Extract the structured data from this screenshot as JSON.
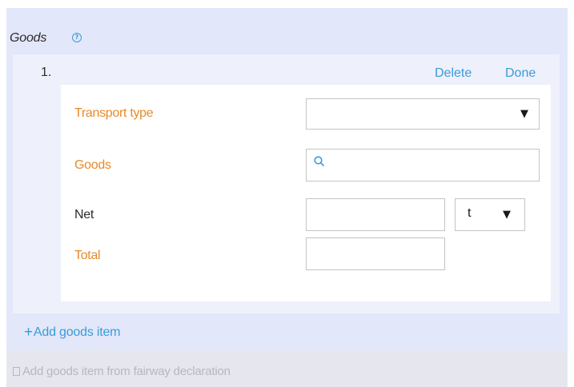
{
  "section": {
    "title": "Goods",
    "help_icon": "?"
  },
  "item": {
    "number": "1.",
    "delete_label": "Delete",
    "done_label": "Done",
    "fields": {
      "transport_type": {
        "label": "Transport type",
        "value": "",
        "required": true
      },
      "goods": {
        "label": "Goods",
        "value": "",
        "required": true,
        "icon": "search-icon"
      },
      "net": {
        "label": "Net",
        "value": "",
        "unit": "t",
        "required": false
      },
      "total": {
        "label": "Total",
        "value": "",
        "required": true
      }
    }
  },
  "actions": {
    "add_goods_item": "Add goods item",
    "add_from_fairway": "Add goods item from fairway declaration"
  },
  "colors": {
    "panel_bg": "#e3e7fa",
    "required_label": "#e88a2a",
    "link": "#3a9bd9",
    "disabled": "#b7b7c2"
  }
}
